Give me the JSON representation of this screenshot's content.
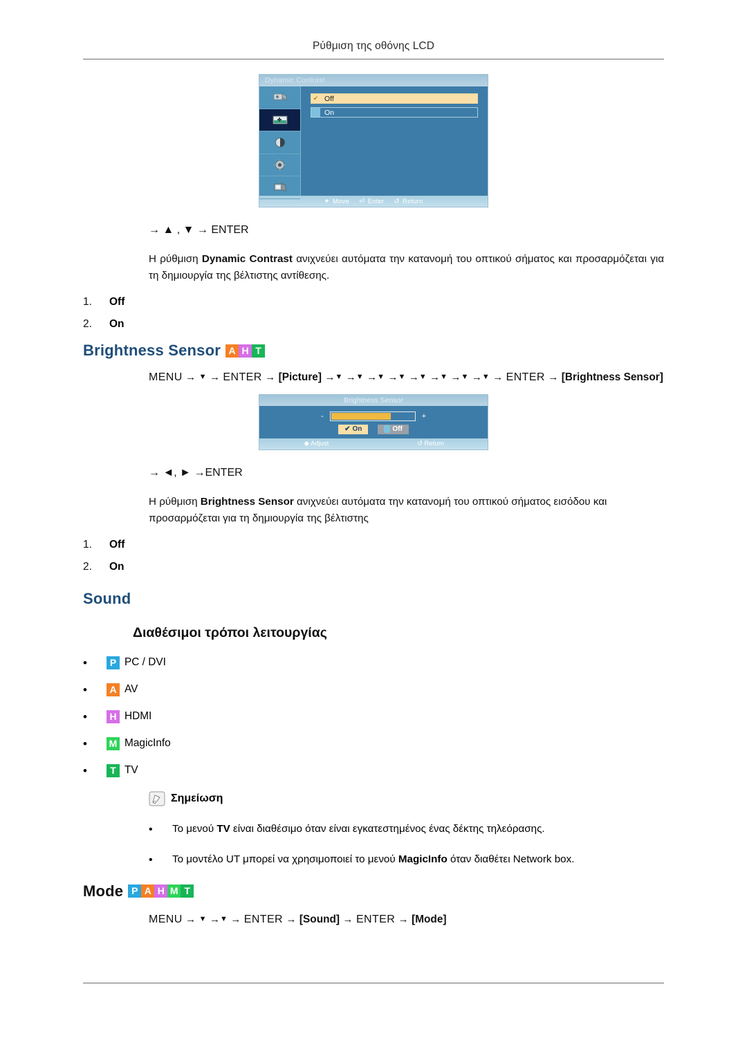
{
  "header": {
    "title": "Ρύθμιση της οθόνης LCD"
  },
  "colors": {
    "badge_pc": "#29a8df",
    "badge_av": "#f58025",
    "badge_hdmi": "#d66ee8",
    "badge_magicinfo": "#2fd35a",
    "badge_tv": "#18b557",
    "osd_panel": "#3d7ca8",
    "osd_highlight": "#fae0a8",
    "osd_selected_side": "#0d1f47",
    "heading_blue": "#1f4e79"
  },
  "dynamic_contrast": {
    "osd": {
      "title": "Dynamic Contrast",
      "options": [
        {
          "label": "Off",
          "selected": true,
          "check": "✔"
        },
        {
          "label": "On",
          "selected": false,
          "check": ""
        }
      ],
      "footer": [
        {
          "icon": "✦",
          "label": "Move"
        },
        {
          "icon": "⏎",
          "label": "Enter"
        },
        {
          "icon": "↺",
          "label": "Return"
        }
      ]
    },
    "nav_line": "→ ▲ , ▼ → ENTER",
    "paragraph_pre": "Η ρύθμιση ",
    "paragraph_bold": "Dynamic Contrast",
    "paragraph_post": " ανιχνεύει αυτόματα την κατανομή του οπτικού σήματος και προσαρμόζεται για τη δημιουργία της βέλτιστης αντίθεσης.",
    "items": [
      {
        "num": "1.",
        "label": "Off"
      },
      {
        "num": "2.",
        "label": "On"
      }
    ]
  },
  "brightness_sensor": {
    "heading": "Brightness Sensor",
    "heading_badges": [
      {
        "letter": "A",
        "color": "#f58025",
        "name": "AV"
      },
      {
        "letter": "H",
        "color": "#d66ee8",
        "name": "HDMI"
      },
      {
        "letter": "T",
        "color": "#18b557",
        "name": "TV"
      }
    ],
    "menu_path": {
      "prefix": "MENU",
      "steps_before": [
        "▼"
      ],
      "enter_1": "ENTER",
      "bracket_1": "[Picture]",
      "downs": [
        "▼",
        "▼",
        "▼",
        "▼",
        "▼",
        "▼",
        "▼",
        "▼"
      ],
      "enter_2": "ENTER",
      "bracket_2": "[Brightness Sensor]"
    },
    "osd": {
      "title": "Brightness Sensor",
      "minus": "-",
      "plus": "+",
      "slider_percent": 72,
      "buttons": [
        {
          "label": "On",
          "state": "selected",
          "check": "✔"
        },
        {
          "label": "Off",
          "state": "normal",
          "check": ""
        }
      ],
      "footer": [
        {
          "icon": "◆",
          "label": "Adjust"
        },
        {
          "icon": "↺",
          "label": "Return"
        }
      ]
    },
    "nav_line": "→ ◄, ► →ENTER",
    "paragraph_pre": "Η ρύθμιση ",
    "paragraph_bold": "Brightness Sensor",
    "paragraph_post": " ανιχνεύει αυτόματα την κατανομή του οπτικού σήματος εισόδου και προσαρμόζεται για τη δημιουργία της βέλτιστης",
    "items": [
      {
        "num": "1.",
        "label": "Off"
      },
      {
        "num": "2.",
        "label": "On"
      }
    ]
  },
  "sound": {
    "heading": "Sound",
    "subheading": "Διαθέσιμοι τρόποι λειτουργίας",
    "modes": [
      {
        "letter": "P",
        "color": "#29a8df",
        "label": "PC / DVI"
      },
      {
        "letter": "A",
        "color": "#f58025",
        "label": "AV"
      },
      {
        "letter": "H",
        "color": "#d66ee8",
        "label": "HDMI"
      },
      {
        "letter": "M",
        "color": "#2fd35a",
        "label": "MagicInfo"
      },
      {
        "letter": "T",
        "color": "#18b557",
        "label": "TV"
      }
    ],
    "note": {
      "label": "Σημείωση",
      "items": [
        {
          "pre": "Το μενού ",
          "bold": "TV",
          "post": " είναι διαθέσιμο όταν είναι εγκατεστημένος ένας δέκτης τηλεόρασης."
        },
        {
          "pre": "Το μοντέλο UT μπορεί να χρησιμοποιεί το μενού ",
          "bold": "MagicInfo",
          "post": " όταν διαθέτει Network box."
        }
      ]
    }
  },
  "mode": {
    "heading": "Mode",
    "heading_badges": [
      {
        "letter": "P",
        "color": "#29a8df",
        "name": "PC"
      },
      {
        "letter": "A",
        "color": "#f58025",
        "name": "AV"
      },
      {
        "letter": "H",
        "color": "#d66ee8",
        "name": "HDMI"
      },
      {
        "letter": "M",
        "color": "#2fd35a",
        "name": "MagicInfo"
      },
      {
        "letter": "T",
        "color": "#18b557",
        "name": "TV"
      }
    ],
    "menu_path": "MENU → ▼ →▼ → ENTER → [Sound] → ENTER → [Mode]",
    "menu_parts": {
      "prefix": "MENU",
      "d1": "▼",
      "d2": "▼",
      "enter_1": "ENTER",
      "bracket_1": "[Sound]",
      "enter_2": "ENTER",
      "bracket_2": "[Mode]"
    }
  }
}
